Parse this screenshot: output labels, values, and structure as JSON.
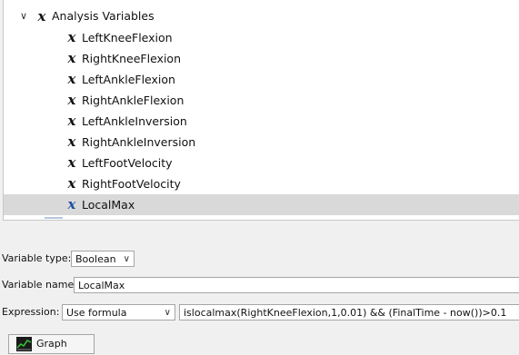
{
  "tree": {
    "root": {
      "expand_icon": "chevron-down-icon",
      "icon": "variable-x-icon",
      "icon_glyph": "x",
      "label": "Analysis Variables"
    },
    "items": [
      {
        "label": "LeftKneeFlexion"
      },
      {
        "label": "RightKneeFlexion"
      },
      {
        "label": "LeftAnkleFlexion"
      },
      {
        "label": "RightAnkleFlexion"
      },
      {
        "label": "LeftAnkleInversion"
      },
      {
        "label": "RightAnkleInversion"
      },
      {
        "label": "LeftFootVelocity"
      },
      {
        "label": "RightFootVelocity"
      },
      {
        "label": "LocalMax",
        "selected": true
      }
    ],
    "item_icon_glyph": "x",
    "selected_icon_color": "#1f4fa0"
  },
  "form": {
    "variable_type": {
      "label": "Variable type:",
      "value": "Boolean"
    },
    "variable_name": {
      "label": "Variable name:",
      "value": "LocalMax"
    },
    "expression": {
      "label": "Expression:",
      "mode": "Use formula",
      "formula": "islocalmax(RightKneeFlexion,1,0.01) && (FinalTime - now())>0.1"
    },
    "graph_button": {
      "label": "Graph",
      "icon": "graph-chart-icon"
    }
  }
}
